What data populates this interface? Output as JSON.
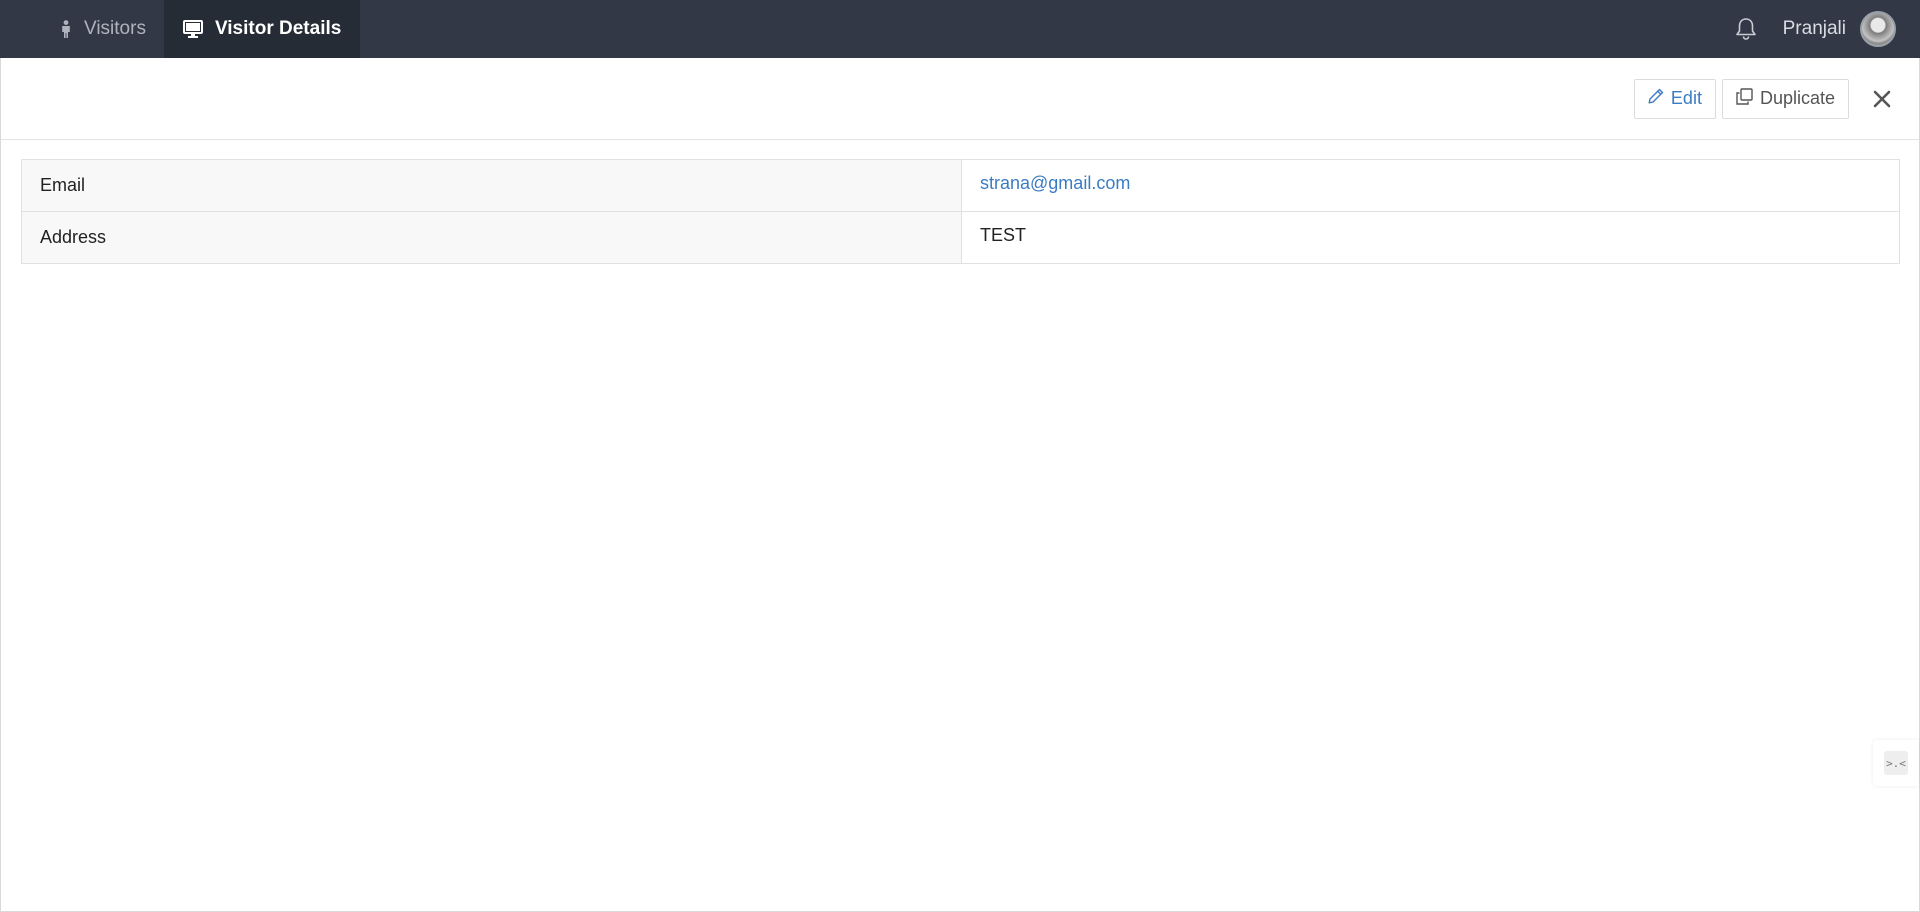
{
  "topbar": {
    "tabs": [
      {
        "label": "Visitors",
        "icon": "person-icon",
        "active": false
      },
      {
        "label": "Visitor Details",
        "icon": "monitor-icon",
        "active": true
      }
    ],
    "notifications_icon": "bell-icon",
    "user": {
      "name": "Pranjali"
    }
  },
  "actions": {
    "edit_label": "Edit",
    "duplicate_label": "Duplicate",
    "close_icon": "close-icon"
  },
  "details": {
    "rows": [
      {
        "label": "Email",
        "value": "strana@gmail.com"
      },
      {
        "label": "Address",
        "value": "TEST"
      }
    ]
  },
  "side_widget": {
    "glyph": ">.<"
  },
  "colors": {
    "topbar_bg": "#323845",
    "active_tab_bg": "#262c36",
    "link": "#3a7cc4"
  }
}
